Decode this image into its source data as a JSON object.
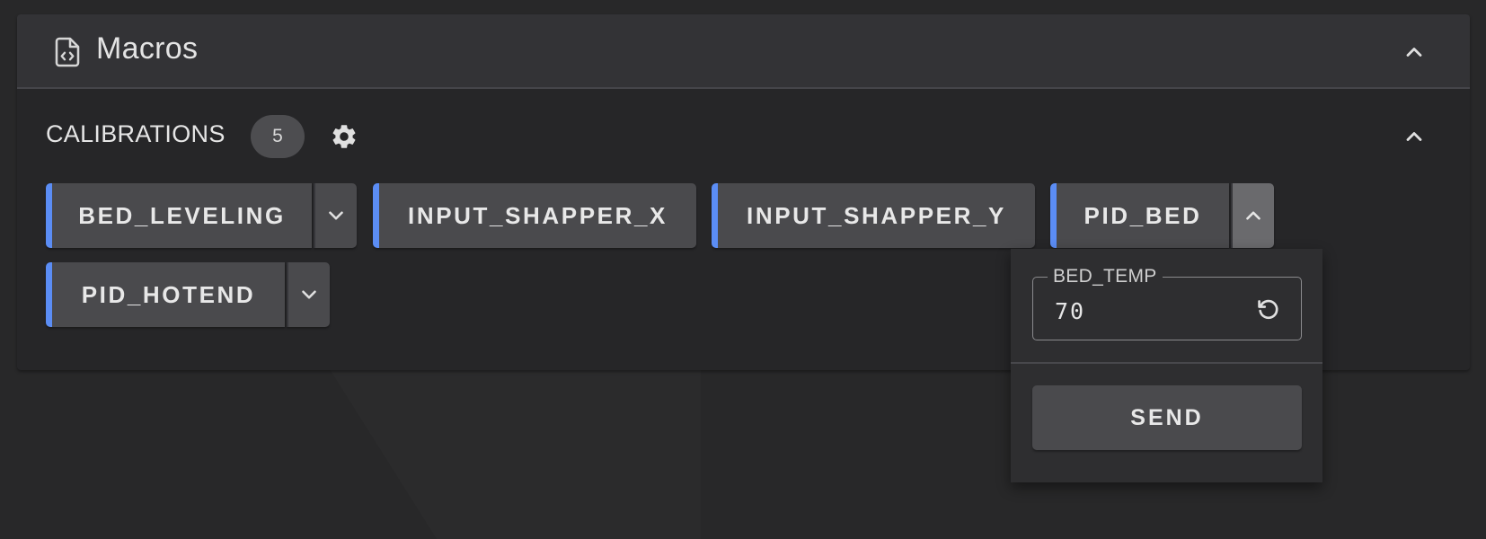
{
  "header": {
    "title": "Macros",
    "icon": "file-code-icon",
    "collapse_icon": "chevron-up-icon"
  },
  "group": {
    "title": "CALIBRATIONS",
    "count": "5",
    "settings_icon": "gear-icon",
    "collapse_icon": "chevron-up-icon"
  },
  "macros": [
    {
      "label": "BED_LEVELING",
      "has_params": true,
      "expanded": false
    },
    {
      "label": "INPUT_SHAPPER_X",
      "has_params": false
    },
    {
      "label": "INPUT_SHAPPER_Y",
      "has_params": false
    },
    {
      "label": "PID_BED",
      "has_params": true,
      "expanded": true
    },
    {
      "label": "PID_HOTEND",
      "has_params": true,
      "expanded": false
    }
  ],
  "popup": {
    "param_label": "BED_TEMP",
    "param_value": "70",
    "reset_icon": "reset-icon",
    "send_label": "SEND"
  },
  "colors": {
    "accent": "#5b8df5",
    "background": "#282829",
    "card": "#262628",
    "header": "#333336",
    "button": "#4a4a4d"
  }
}
